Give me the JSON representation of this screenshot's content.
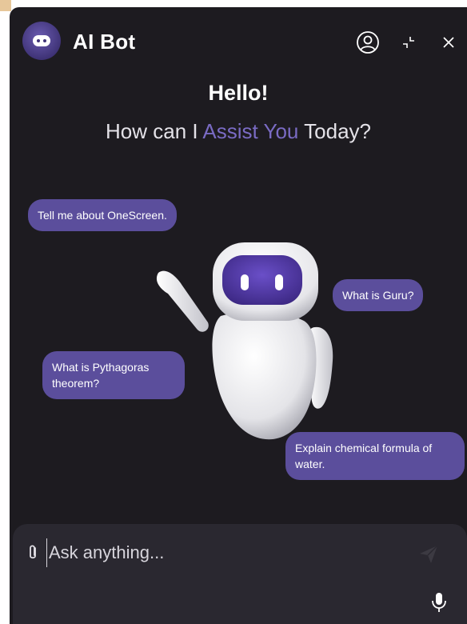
{
  "header": {
    "title": "AI Bot",
    "icons": [
      "bot-logo-icon",
      "profile-icon",
      "minimize-icon",
      "close-icon"
    ]
  },
  "greeting": {
    "hello": "Hello!",
    "subtitle_prefix": "How can I ",
    "subtitle_accent": "Assist You",
    "subtitle_suffix": " Today?"
  },
  "suggestions": [
    "Tell me about OneScreen.",
    "What is Guru?",
    "What is Pythagoras theorem?",
    "Explain chemical formula of water."
  ],
  "composer": {
    "placeholder": "Ask anything...",
    "value": "",
    "icons": [
      "paperclip-icon",
      "send-icon",
      "microphone-icon"
    ]
  },
  "colors": {
    "background": "#1d1b20",
    "accent": "#7a6bc4",
    "chip": "#5b4e9c",
    "composer": "#2a2830"
  }
}
